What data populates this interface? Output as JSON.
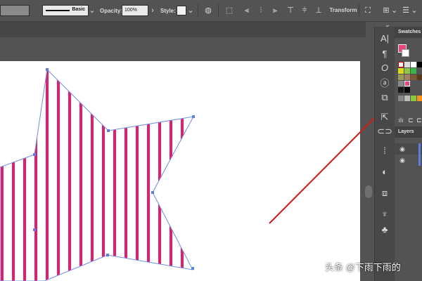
{
  "controlbar": {
    "stroke_profile_label": "Basic",
    "opacity_label": "Opacity:",
    "opacity_value": "100%",
    "style_label": "Style:",
    "transform_label": "Transform"
  },
  "panels": {
    "swatches_title": "Swatches",
    "layers_title": "Layers",
    "collapse_arrows": "«"
  },
  "tools": [
    "type-icon",
    "paragraph-icon",
    "glyph-icon",
    "character-styles-icon",
    "graphic-styles-icon",
    "export-icon",
    "link-icon",
    "align-icon",
    "pathfinder-icon",
    "transparency-icon",
    "symbols-icon",
    "club-icon"
  ],
  "swatch_colors": {
    "pink": "#e8457f",
    "stripe": "#e0206f",
    "selection": "#5c7fe0",
    "arrow": "#cc1a1a"
  },
  "watermark": "头条 @下雨下雨的"
}
